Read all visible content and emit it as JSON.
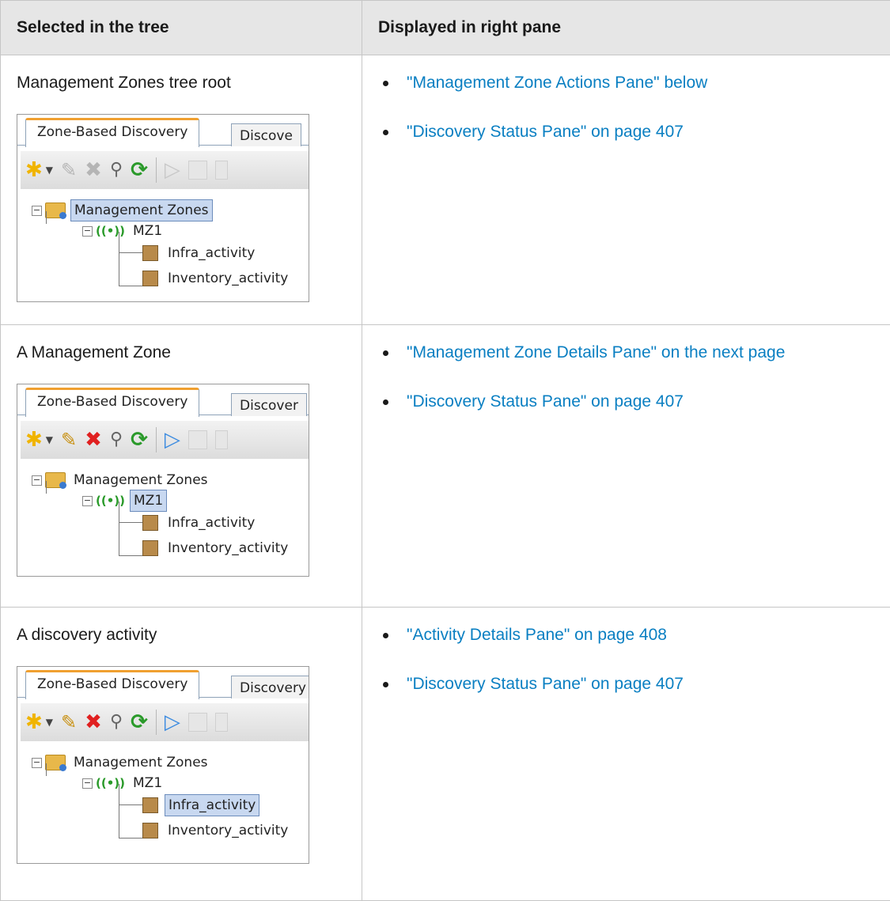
{
  "table": {
    "header": {
      "col1": "Selected in the tree",
      "col2": "Displayed in right pane"
    },
    "rows": [
      {
        "title": "Management Zones tree root",
        "links": [
          "\"Management Zone Actions Pane\" below",
          "\"Discovery Status Pane\" on page 407"
        ],
        "widget": {
          "tab_active": "Zone-Based Discovery",
          "tab_inactive": "Discove",
          "tree": {
            "root": "Management Zones",
            "zone": "MZ1",
            "activity1": "Infra_activity",
            "activity2": "Inventory_activity"
          }
        }
      },
      {
        "title": "A Management Zone",
        "links": [
          "\"Management Zone Details Pane\" on the next page",
          "\"Discovery Status Pane\" on page 407"
        ],
        "widget": {
          "tab_active": "Zone-Based Discovery",
          "tab_inactive": "Discover",
          "tree": {
            "root": "Management Zones",
            "zone": "MZ1",
            "activity1": "Infra_activity",
            "activity2": "Inventory_activity"
          }
        }
      },
      {
        "title": "A discovery activity",
        "links": [
          "\"Activity Details Pane\" on page 408",
          "\"Discovery Status Pane\" on page 407"
        ],
        "widget": {
          "tab_active": "Zone-Based Discovery",
          "tab_inactive": "Discovery",
          "tree": {
            "root": "Management Zones",
            "zone": "MZ1",
            "activity1": "Infra_activity",
            "activity2": "Inventory_activity"
          }
        }
      }
    ]
  },
  "icons": {
    "new": "asterisk-icon",
    "edit": "pencil-icon",
    "delete": "x-icon",
    "find": "magnifier-icon",
    "refresh": "refresh-icon",
    "run": "play-icon",
    "stop": "stop-icon",
    "pause": "pause-icon",
    "folder": "folder-icon",
    "zone": "radio-signal-icon",
    "activity": "package-icon"
  },
  "colors": {
    "link": "#0a7fc2",
    "header_bg": "#e6e6e6",
    "selection": "#c8d8f0",
    "tab_accent": "#f0a030"
  }
}
